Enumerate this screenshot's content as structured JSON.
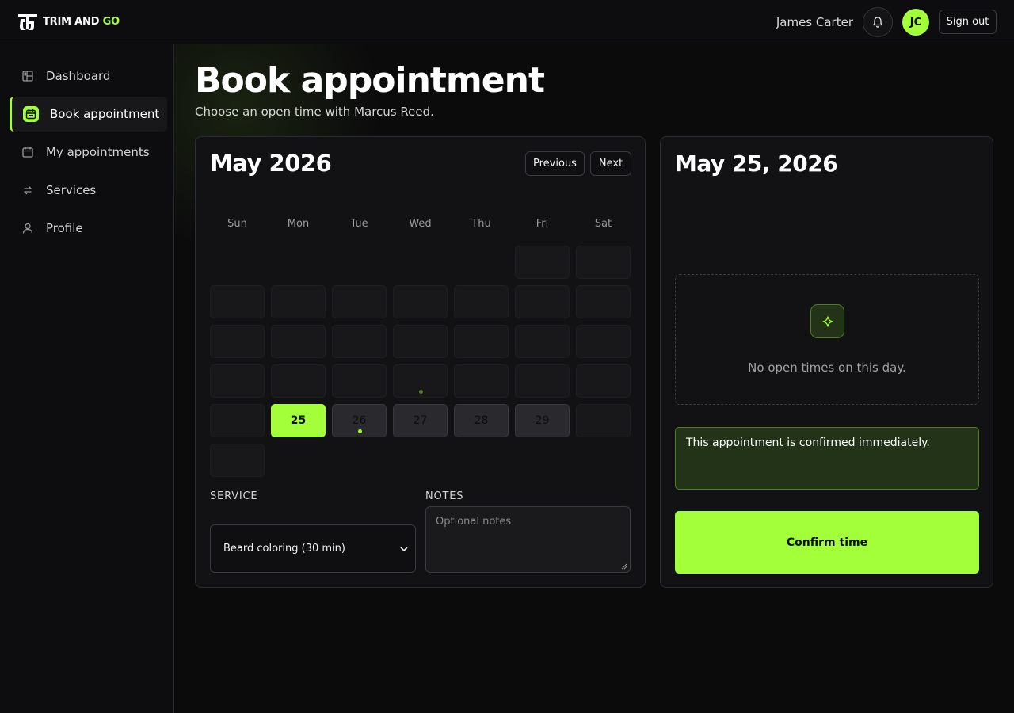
{
  "brand": {
    "name_part1": "TRIM AND",
    "name_part2": "GO",
    "accent_color": "#a3ff3a"
  },
  "header": {
    "user_name": "James Carter",
    "avatar_initials": "JC",
    "sign_out_label": "Sign out",
    "bell_icon": "bell-icon"
  },
  "sidebar": {
    "items": [
      {
        "label": "Dashboard",
        "icon": "dashboard-icon",
        "active": false
      },
      {
        "label": "Book appointment",
        "icon": "calendar-book-icon",
        "active": true
      },
      {
        "label": "My appointments",
        "icon": "calendar-icon",
        "active": false
      },
      {
        "label": "Services",
        "icon": "swap-icon",
        "active": false
      },
      {
        "label": "Profile",
        "icon": "user-icon",
        "active": false
      }
    ]
  },
  "main": {
    "title": "Book appointment",
    "subtitle": "Choose an open time with Marcus Reed."
  },
  "calendar": {
    "month_label": "May 2026",
    "prev_label": "Previous",
    "next_label": "Next",
    "weekdays": [
      "Sun",
      "Mon",
      "Tue",
      "Wed",
      "Thu",
      "Fri",
      "Sat"
    ],
    "days": {
      "d25": "25",
      "d26": "26",
      "d27": "27",
      "d28": "28",
      "d29": "29"
    },
    "service_label": "SERVICE",
    "service_value": "Beard coloring (30 min)",
    "notes_label": "NOTES",
    "notes_placeholder": "Optional notes"
  },
  "day_panel": {
    "date_title": "May 25, 2026",
    "empty_message": "No open times on this day.",
    "notice": "This appointment is confirmed immediately.",
    "confirm_label": "Confirm time"
  }
}
